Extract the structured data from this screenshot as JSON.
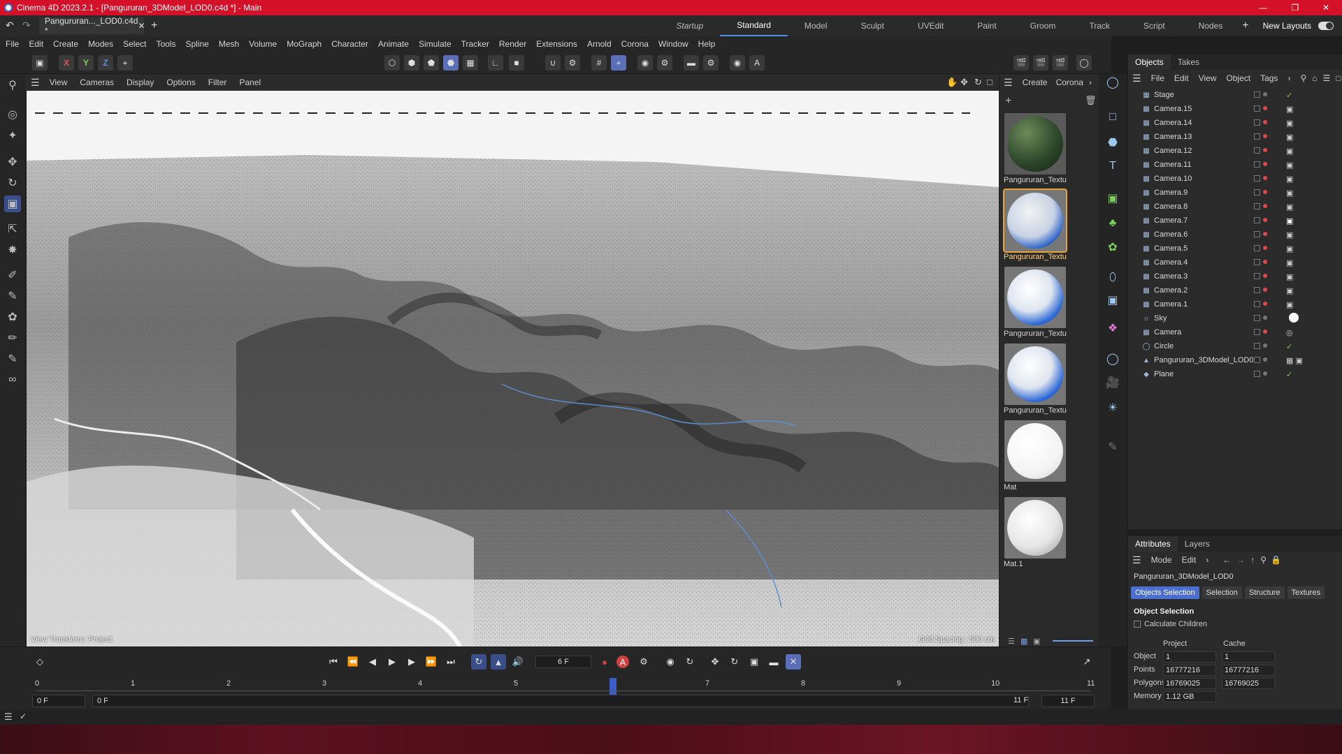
{
  "window": {
    "title": "Cinema 4D 2023.2.1 - [Pangururan_3DModel_LOD0.c4d *] - Main",
    "doc_tab": "Pangururan..._LOD0.c4d *",
    "titlebar_color": "#d5112a"
  },
  "layouts": {
    "items": [
      "Startup",
      "Standard",
      "Model",
      "Sculpt",
      "UVEdit",
      "Paint",
      "Groom",
      "Track",
      "Script",
      "Nodes"
    ],
    "active": "Standard",
    "new_layouts": "New Layouts"
  },
  "menu": [
    "File",
    "Edit",
    "Create",
    "Modes",
    "Select",
    "Tools",
    "Spline",
    "Mesh",
    "Volume",
    "MoGraph",
    "Character",
    "Animate",
    "Simulate",
    "Tracker",
    "Render",
    "Extensions",
    "Arnold",
    "Corona",
    "Window",
    "Help"
  ],
  "toolbar": {
    "axis_x": "X",
    "axis_y": "Y",
    "axis_z": "Z"
  },
  "viewport": {
    "menu": [
      "View",
      "Cameras",
      "Display",
      "Options",
      "Filter",
      "Panel"
    ],
    "footer_left": "View Transform: Project",
    "footer_right": "Grid Spacing : 500 cm"
  },
  "materials_panel": {
    "menu": [
      "Create",
      "Corona"
    ],
    "items": [
      {
        "label": "Pangururan_Textu",
        "kind": "terrain"
      },
      {
        "label": "Pangururan_Textu",
        "kind": "blue",
        "selected": true
      },
      {
        "label": "Pangururan_Textu",
        "kind": "blue"
      },
      {
        "label": "Pangururan_Textu",
        "kind": "blue"
      },
      {
        "label": "Mat",
        "kind": "white"
      },
      {
        "label": "Mat.1",
        "kind": "white"
      }
    ]
  },
  "objects_manager": {
    "tabs": [
      "Objects",
      "Takes"
    ],
    "active_tab": "Objects",
    "menu": [
      "File",
      "Edit",
      "View",
      "Object",
      "Tags"
    ],
    "objects": [
      {
        "name": "Stage",
        "icon": "stage-icon"
      },
      {
        "name": "Camera.15",
        "icon": "camera-icon"
      },
      {
        "name": "Camera.14",
        "icon": "camera-icon"
      },
      {
        "name": "Camera.13",
        "icon": "camera-icon"
      },
      {
        "name": "Camera.12",
        "icon": "camera-icon"
      },
      {
        "name": "Camera.11",
        "icon": "camera-icon"
      },
      {
        "name": "Camera.10",
        "icon": "camera-icon"
      },
      {
        "name": "Camera.9",
        "icon": "camera-icon"
      },
      {
        "name": "Camera.8",
        "icon": "camera-icon"
      },
      {
        "name": "Camera.7",
        "icon": "camera-icon"
      },
      {
        "name": "Camera.6",
        "icon": "camera-icon"
      },
      {
        "name": "Camera.5",
        "icon": "camera-icon"
      },
      {
        "name": "Camera.4",
        "icon": "camera-icon"
      },
      {
        "name": "Camera.3",
        "icon": "camera-icon"
      },
      {
        "name": "Camera.2",
        "icon": "camera-icon"
      },
      {
        "name": "Camera.1",
        "icon": "camera-icon"
      },
      {
        "name": "Sky",
        "icon": "sky-icon"
      },
      {
        "name": "Camera",
        "icon": "camera-icon"
      },
      {
        "name": "Circle",
        "icon": "circle-icon"
      },
      {
        "name": "Pangururan_3DModel_LOD0",
        "icon": "polygon-icon"
      },
      {
        "name": "Plane",
        "icon": "plane-icon"
      }
    ]
  },
  "attributes": {
    "tabs": [
      "Attributes",
      "Layers"
    ],
    "active_tab": "Attributes",
    "menu": [
      "Mode",
      "Edit"
    ],
    "object_name": "Pangururan_3DModel_LOD0",
    "sel_tabs": [
      "Objects Selection",
      "Selection",
      "Structure",
      "Textures"
    ],
    "active_sel_tab": "Objects Selection",
    "section": "Object Selection",
    "calc_children": "Calculate Children",
    "col_project": "Project",
    "col_cache": "Cache",
    "rows": [
      {
        "label": "Object",
        "project": "1",
        "cache": "1"
      },
      {
        "label": "Points",
        "project": "16777216",
        "cache": "16777216"
      },
      {
        "label": "Polygons",
        "project": "16769025",
        "cache": "16769025"
      },
      {
        "label": "Memory",
        "project": "1.12 GB",
        "cache": ""
      }
    ]
  },
  "timeline": {
    "current_frame": "6 F",
    "start_field": "0 F",
    "start_field2": "0 F",
    "end_field": "11 F",
    "end_field2": "11 F",
    "ruler": [
      "0",
      "1",
      "2",
      "3",
      "4",
      "5",
      "6",
      "7",
      "8",
      "9",
      "10",
      "11"
    ],
    "playhead": 6
  },
  "colors": {
    "accent": "#4f8fe8",
    "selection_outline": "#e8a23a",
    "active_tab": "#4a6fd0"
  }
}
